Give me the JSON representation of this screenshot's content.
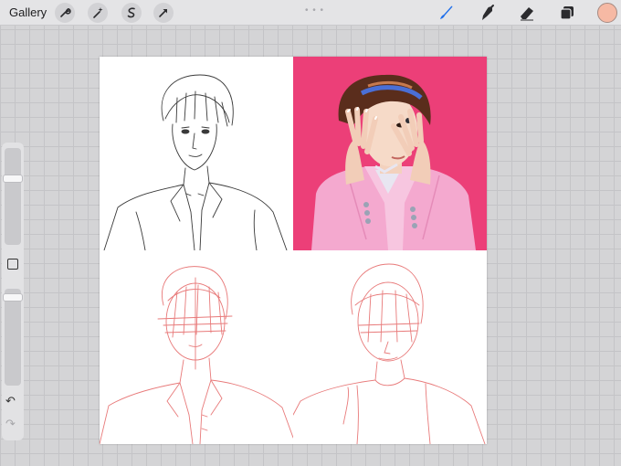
{
  "toolbar": {
    "gallery_label": "Gallery",
    "left_tools": [
      "wrench-icon",
      "magic-wand-icon",
      "selection-icon",
      "transform-arrow-icon"
    ],
    "right_tools": [
      "brush-icon",
      "smudge-icon",
      "eraser-icon",
      "layers-icon"
    ],
    "active_tool": "brush-icon",
    "accent_color": "#1f6feb",
    "current_color": "#f6b9a4"
  },
  "sidebar": {
    "brush_size_level": 0.7,
    "opacity_level": 0.95,
    "undo_glyph": "↶",
    "redo_glyph": "↷"
  },
  "canvas": {
    "background": "#ffffff",
    "panels": [
      {
        "name": "black-lineart-panel",
        "style": "black line art"
      },
      {
        "name": "colored-illustration-panel",
        "style": "pink background illustration",
        "background": "#ec3f78",
        "jacket": "#f4a9cf"
      },
      {
        "name": "red-sketch-panel-left",
        "style": "red sketch"
      },
      {
        "name": "red-sketch-panel-right",
        "style": "red sketch"
      }
    ]
  }
}
